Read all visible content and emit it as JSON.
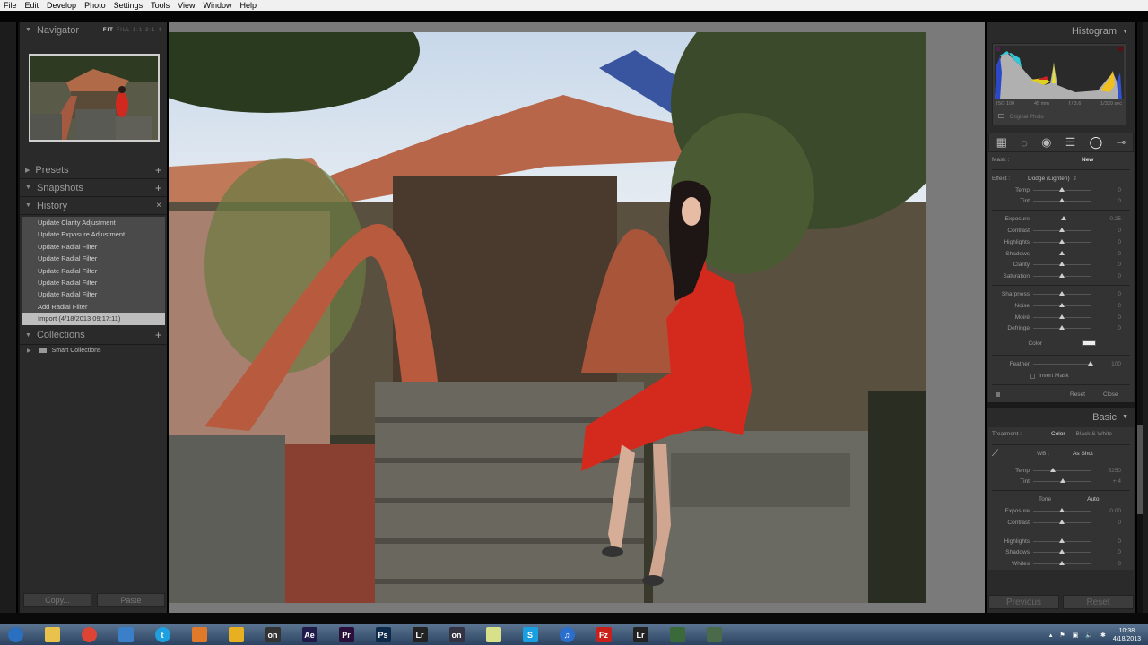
{
  "menu": [
    "File",
    "Edit",
    "Develop",
    "Photo",
    "Settings",
    "Tools",
    "View",
    "Window",
    "Help"
  ],
  "left_panel": {
    "navigator": {
      "title": "Navigator",
      "options": [
        "FIT",
        "FILL",
        "1:1",
        "3:1"
      ],
      "active": "FIT"
    },
    "presets": {
      "title": "Presets"
    },
    "snapshots": {
      "title": "Snapshots"
    },
    "history": {
      "title": "History",
      "items": [
        "Update Clarity Adjustment",
        "Update Exposure Adjustment",
        "Update Radial Filter",
        "Update Radial Filter",
        "Update Radial Filter",
        "Update Radial Filter",
        "Update Radial Filter",
        "Add Radial Filter",
        "Import (4/18/2013 09:17:11)"
      ],
      "selected_index": 8
    },
    "collections": {
      "title": "Collections",
      "items": [
        "Smart Collections"
      ]
    },
    "copy_label": "Copy...",
    "paste_label": "Paste"
  },
  "right_panel": {
    "histogram": {
      "title": "Histogram",
      "iso": "ISO 100",
      "focal": "45 mm",
      "aperture": "f / 3.6",
      "shutter": "1/320 sec",
      "original_photo": "Original Photo"
    },
    "mask": {
      "label": "Mask :",
      "new_label": "New"
    },
    "effect": {
      "label": "Effect :",
      "value": "Dodge (Lighten)"
    },
    "sliders_group1": [
      {
        "label": "Temp",
        "value": "0",
        "pos": 0.5
      },
      {
        "label": "Tint",
        "value": "0",
        "pos": 0.5
      }
    ],
    "sliders_group2": [
      {
        "label": "Exposure",
        "value": "0.25",
        "pos": 0.53
      },
      {
        "label": "Contrast",
        "value": "0",
        "pos": 0.5
      },
      {
        "label": "Highlights",
        "value": "0",
        "pos": 0.5
      },
      {
        "label": "Shadows",
        "value": "0",
        "pos": 0.5
      },
      {
        "label": "Clarity",
        "value": "0",
        "pos": 0.5
      },
      {
        "label": "Saturation",
        "value": "0",
        "pos": 0.5
      }
    ],
    "sliders_group3": [
      {
        "label": "Sharpness",
        "value": "0",
        "pos": 0.5
      },
      {
        "label": "Noise",
        "value": "0",
        "pos": 0.5
      },
      {
        "label": "Moiré",
        "value": "0",
        "pos": 0.5
      },
      {
        "label": "Defringe",
        "value": "0",
        "pos": 0.5
      }
    ],
    "color_label": "Color",
    "feather": {
      "label": "Feather",
      "value": "100",
      "pos": 1.0
    },
    "invert_mask": "Invert Mask",
    "reset_label": "Reset",
    "close_label": "Close",
    "basic": {
      "title": "Basic",
      "treatment_label": "Treatment :",
      "color": "Color",
      "bw": "Black & White",
      "wb_label": "WB :",
      "wb_value": "As Shot",
      "wb_sliders": [
        {
          "label": "Temp",
          "value": "5250",
          "pos": 0.35
        },
        {
          "label": "Tint",
          "value": "+ 4",
          "pos": 0.52
        }
      ],
      "tone_label": "Tone",
      "auto_label": "Auto",
      "tone_sliders": [
        {
          "label": "Exposure",
          "value": "0.00",
          "pos": 0.5
        },
        {
          "label": "Contrast",
          "value": "0",
          "pos": 0.5
        }
      ],
      "tone_sliders2": [
        {
          "label": "Highlights",
          "value": "0",
          "pos": 0.5
        },
        {
          "label": "Shadows",
          "value": "0",
          "pos": 0.5
        },
        {
          "label": "Whites",
          "value": "0",
          "pos": 0.5
        }
      ]
    },
    "previous_label": "Previous",
    "reset_all_label": "Reset"
  },
  "taskbar": {
    "apps": [
      {
        "name": "start",
        "label": "",
        "color": "#2a6fc0"
      },
      {
        "name": "explorer",
        "label": "",
        "color": "#e8c24a"
      },
      {
        "name": "chrome",
        "label": "",
        "color": "#dd4433"
      },
      {
        "name": "twitter",
        "label": "",
        "color": "#3a7fc8"
      },
      {
        "name": "skype-t",
        "label": "t",
        "color": "#1ea0e0"
      },
      {
        "name": "app-orange",
        "label": "",
        "color": "#e07a2a"
      },
      {
        "name": "app-yellow",
        "label": "",
        "color": "#e8b020"
      },
      {
        "name": "on1",
        "label": "on",
        "color": "#333"
      },
      {
        "name": "after-effects",
        "label": "Ae",
        "color": "#1e1a4a"
      },
      {
        "name": "premiere",
        "label": "Pr",
        "color": "#2a0f3a"
      },
      {
        "name": "photoshop",
        "label": "Ps",
        "color": "#0e2a4a"
      },
      {
        "name": "lightroom",
        "label": "Lr",
        "color": "#222"
      },
      {
        "name": "on1-2",
        "label": "on",
        "color": "#334"
      },
      {
        "name": "sticky-notes",
        "label": "",
        "color": "#d8e08a"
      },
      {
        "name": "skype",
        "label": "S",
        "color": "#1aa0e0"
      },
      {
        "name": "itunes",
        "label": "♫",
        "color": "#2a6fd0"
      },
      {
        "name": "filezilla",
        "label": "Fz",
        "color": "#c8201a"
      },
      {
        "name": "lightroom-2",
        "label": "Lr",
        "color": "#222"
      },
      {
        "name": "app-green",
        "label": "",
        "color": "#3a6a3a"
      },
      {
        "name": "app-green-red",
        "label": "",
        "color": "#4a6a4a"
      }
    ],
    "time": "10:38",
    "date": "4/18/2013"
  }
}
